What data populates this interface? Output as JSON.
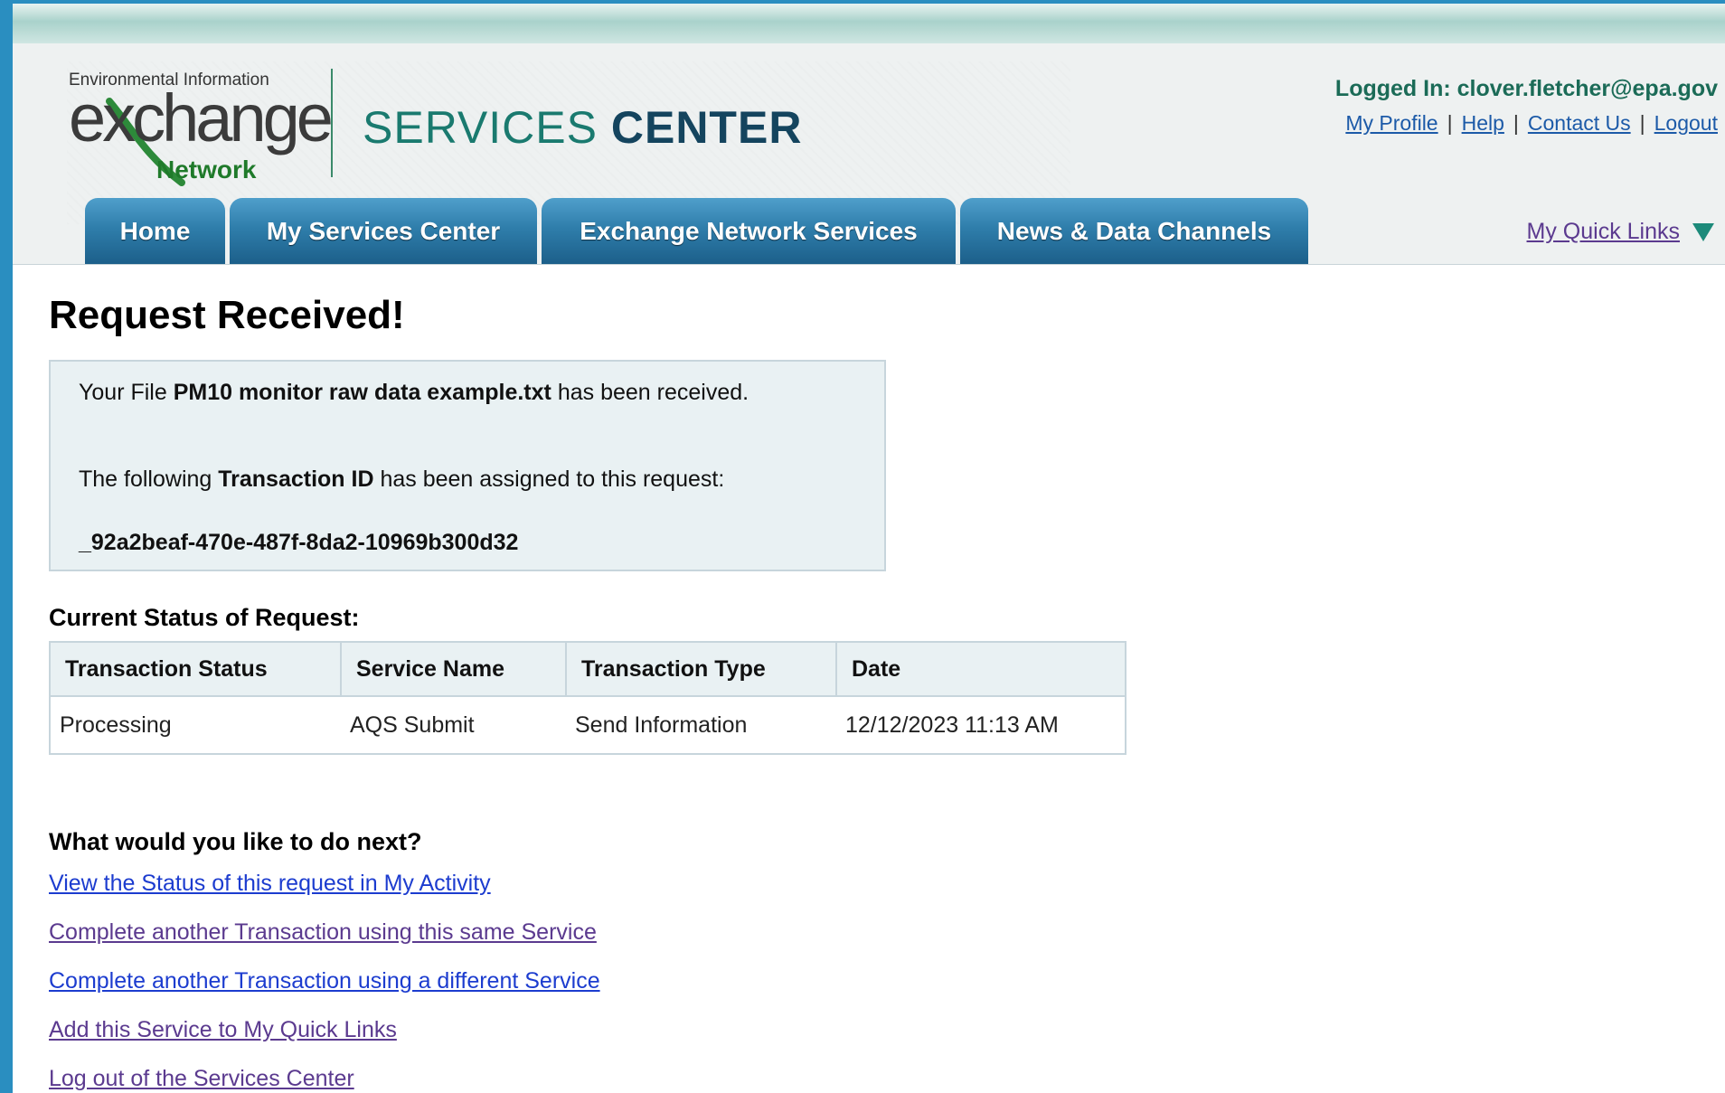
{
  "header": {
    "logo": {
      "top_text": "Environmental Information",
      "main_text": "exchange",
      "bottom_text": "Network"
    },
    "services": {
      "word1": "SERVICES",
      "word2": "CENTER"
    },
    "user": {
      "logged_in": "Logged In: clover.fletcher@epa.gov",
      "links": {
        "my_profile": "My Profile",
        "help": "Help",
        "contact_us": "Contact Us",
        "logout": "Logout"
      }
    }
  },
  "nav": {
    "tabs": [
      {
        "label": "Home"
      },
      {
        "label": "My Services Center"
      },
      {
        "label": "Exchange Network Services"
      },
      {
        "label": "News & Data Channels"
      }
    ],
    "quick_links": "My Quick Links",
    "quick_links_icon": "triangle-down-icon"
  },
  "main": {
    "title": "Request Received!",
    "receipt": {
      "line1_prefix": "Your File ",
      "file_name": "PM10 monitor raw data example.txt",
      "line1_suffix": " has been received.",
      "line2_prefix": "The following ",
      "line2_bold": "Transaction ID",
      "line2_suffix": " has been assigned to this request:",
      "transaction_id": "_92a2beaf-470e-487f-8da2-10969b300d32"
    },
    "status_heading": "Current Status of Request:",
    "table": {
      "headers": [
        "Transaction Status",
        "Service Name",
        "Transaction Type",
        "Date"
      ],
      "rows": [
        [
          "Processing",
          "AQS Submit",
          "Send Information",
          "12/12/2023 11:13 AM"
        ]
      ]
    },
    "next_heading": "What would you like to do next?",
    "next_links": [
      "View the Status of this request in My Activity",
      "Complete another Transaction using this same Service",
      "Complete another Transaction using a different Service",
      "Add this Service to My Quick Links",
      "Log out of the Services Center"
    ]
  },
  "colors": {
    "tab_blue": "#2f7eab",
    "brand_green": "#1b6b57",
    "link_blue": "#1c3ccf",
    "link_visited": "#5b3a8f",
    "box_bg": "#e9f1f3"
  }
}
